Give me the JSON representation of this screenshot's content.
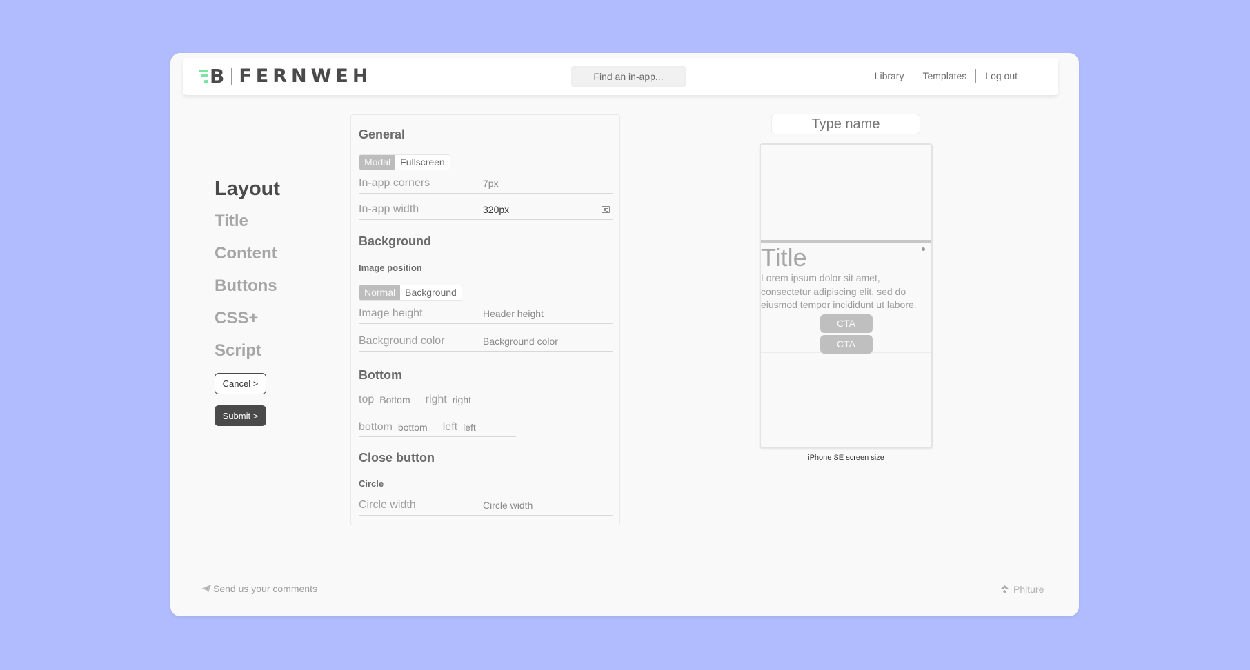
{
  "header": {
    "logo_mark": "B",
    "logo_text": "FERNWEH",
    "search_placeholder": "Find an in-app...",
    "nav": [
      "Library",
      "Templates",
      "Log out"
    ]
  },
  "sidebar": {
    "items": [
      {
        "label": "Layout",
        "active": true
      },
      {
        "label": "Title",
        "active": false
      },
      {
        "label": "Content",
        "active": false
      },
      {
        "label": "Buttons",
        "active": false
      },
      {
        "label": "CSS+",
        "active": false
      },
      {
        "label": "Script",
        "active": false
      }
    ],
    "cancel_label": "Cancel >",
    "submit_label": "Submit >"
  },
  "panel": {
    "general": {
      "title": "General",
      "mode_options": [
        "Modal",
        "Fullscreen"
      ],
      "mode_selected": "Modal",
      "corners_label": "In-app corners",
      "corners_value": "7px",
      "width_label": "In-app width",
      "width_value": "320px"
    },
    "background": {
      "title": "Background",
      "image_position_label": "Image position",
      "position_options": [
        "Normal",
        "Background"
      ],
      "position_selected": "Normal",
      "image_height_label": "Image height",
      "image_height_placeholder": "Header height",
      "bg_color_label": "Background color",
      "bg_color_placeholder": "Background color"
    },
    "bottom": {
      "title": "Bottom",
      "top_label": "top",
      "top_value": "Bottom",
      "right_label": "right",
      "right_value": "right",
      "bottom_label": "bottom",
      "bottom_value": "bottom",
      "left_label": "left",
      "left_value": "left"
    },
    "close_button": {
      "title": "Close button",
      "circle_label": "Circle",
      "circle_width_label": "Circle width",
      "circle_width_placeholder": "Circle width"
    }
  },
  "preview": {
    "name_placeholder": "Type name",
    "title": "Title",
    "body": "Lorem ipsum dolor sit amet, consectetur adipiscing elit, sed do eiusmod tempor incididunt ut labore.",
    "cta_labels": [
      "CTA",
      "CTA"
    ],
    "caption": "iPhone SE screen size"
  },
  "footer": {
    "comments": "Send us your comments",
    "brand": "Phiture"
  },
  "colors": {
    "background": "#b0bcfd",
    "logo_accent": "#79e6a0",
    "dark": "#4a4a4a"
  }
}
